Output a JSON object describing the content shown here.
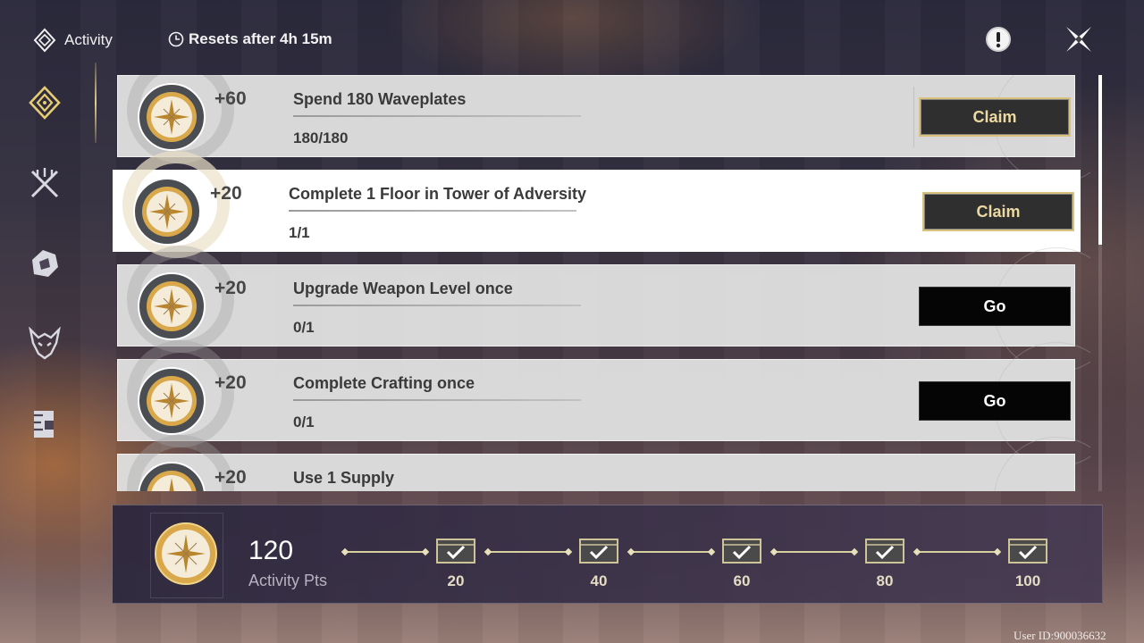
{
  "header": {
    "section_label": "Activity",
    "reset_text": "Resets after 4h 15m"
  },
  "sidebar": {
    "items": [
      {
        "icon": "activity-diamond-icon",
        "active": true
      },
      {
        "icon": "crossed-swords-icon",
        "active": false
      },
      {
        "icon": "shard-icon",
        "active": false
      },
      {
        "icon": "demon-mask-icon",
        "active": false
      },
      {
        "icon": "door-icon",
        "active": false
      }
    ]
  },
  "tasks": [
    {
      "points": "+60",
      "title": "Spend 180 Waveplates",
      "progress": "180/180",
      "button": "Claim",
      "state": "claim"
    },
    {
      "points": "+20",
      "title": "Complete 1 Floor in Tower of Adversity",
      "progress": "1/1",
      "button": "Claim",
      "state": "claim"
    },
    {
      "points": "+20",
      "title": "Upgrade Weapon Level once",
      "progress": "0/1",
      "button": "Go",
      "state": "go"
    },
    {
      "points": "+20",
      "title": "Complete Crafting once",
      "progress": "0/1",
      "button": "Go",
      "state": "go"
    },
    {
      "points": "+20",
      "title": "Use 1 Supply",
      "progress": "",
      "button": "",
      "state": "go"
    }
  ],
  "summary": {
    "total": "120",
    "label": "Activity Pts",
    "milestones": [
      "20",
      "40",
      "60",
      "80",
      "100"
    ]
  },
  "footer": {
    "user_id": "User ID:900036632"
  },
  "colors": {
    "gold": "#d9c17c",
    "claim_bg": "#2f2f2f",
    "go_bg": "#050505"
  }
}
